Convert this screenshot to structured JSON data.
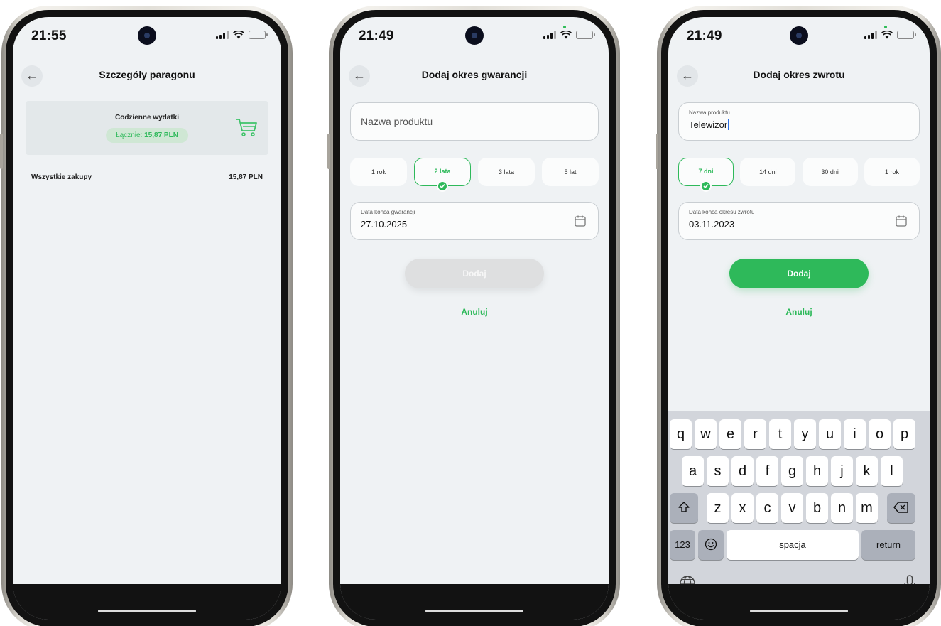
{
  "phones": [
    {
      "status": {
        "time": "21:55"
      },
      "header": {
        "back_icon": "arrow-left-icon",
        "title": "Szczegóły paragonu"
      },
      "receipt_card": {
        "category": "Codzienne wydatki",
        "total_label": "Łącznie:",
        "total_value": "15,87 PLN",
        "icon": "shopping-cart-icon"
      },
      "summary_row": {
        "label": "Wszystkie zakupy",
        "value": "15,87 PLN"
      }
    },
    {
      "status": {
        "time": "21:49"
      },
      "header": {
        "back_icon": "arrow-left-icon",
        "title": "Dodaj okres gwarancji"
      },
      "product_field": {
        "placeholder": "Nazwa produktu"
      },
      "period_options": [
        {
          "label": "1 rok",
          "selected": false
        },
        {
          "label": "2 lata",
          "selected": true
        },
        {
          "label": "3 lata",
          "selected": false
        },
        {
          "label": "5 lat",
          "selected": false
        }
      ],
      "date_field": {
        "label": "Data końca gwarancji",
        "value": "27.10.2025",
        "icon": "calendar-icon"
      },
      "add_button": {
        "label": "Dodaj",
        "enabled": false
      },
      "cancel_link": {
        "label": "Anuluj"
      }
    },
    {
      "status": {
        "time": "21:49"
      },
      "header": {
        "back_icon": "arrow-left-icon",
        "title": "Dodaj okres zwrotu"
      },
      "product_field": {
        "label": "Nazwa produktu",
        "value": "Telewizor"
      },
      "period_options": [
        {
          "label": "7 dni",
          "selected": true
        },
        {
          "label": "14 dni",
          "selected": false
        },
        {
          "label": "30 dni",
          "selected": false
        },
        {
          "label": "1 rok",
          "selected": false
        }
      ],
      "date_field": {
        "label": "Data końca okresu zwrotu",
        "value": "03.11.2023",
        "icon": "calendar-icon"
      },
      "add_button": {
        "label": "Dodaj",
        "enabled": true
      },
      "cancel_link": {
        "label": "Anuluj"
      },
      "keyboard": {
        "row1": [
          "q",
          "w",
          "e",
          "r",
          "t",
          "y",
          "u",
          "i",
          "o",
          "p"
        ],
        "row2": [
          "a",
          "s",
          "d",
          "f",
          "g",
          "h",
          "j",
          "k",
          "l"
        ],
        "row3": [
          "z",
          "x",
          "c",
          "v",
          "b",
          "n",
          "m"
        ],
        "numbers_key": "123",
        "space_key": "spacja",
        "return_key": "return"
      }
    }
  ],
  "colors": {
    "accent": "#2eb95a",
    "screen_bg": "#eff2f4",
    "disabled_button": "#dedfe0"
  }
}
